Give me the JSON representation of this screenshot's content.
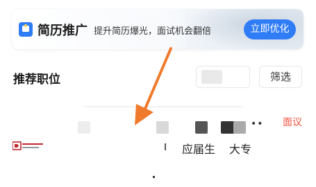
{
  "banner": {
    "title": "简历推广",
    "subtitle": "提升简历爆光，面试机会翻倍",
    "button_label": "立即优化",
    "icon": "resume-icon",
    "accent": "#2f7cf6"
  },
  "section": {
    "title": "推荐职位",
    "filter_label": "筛选"
  },
  "job": {
    "tag": "面议",
    "tag_color": "#f0523f",
    "dots": "••",
    "tags": [
      "应届生",
      "大专"
    ]
  },
  "annotation": {
    "arrow_color": "#f07a2c"
  }
}
